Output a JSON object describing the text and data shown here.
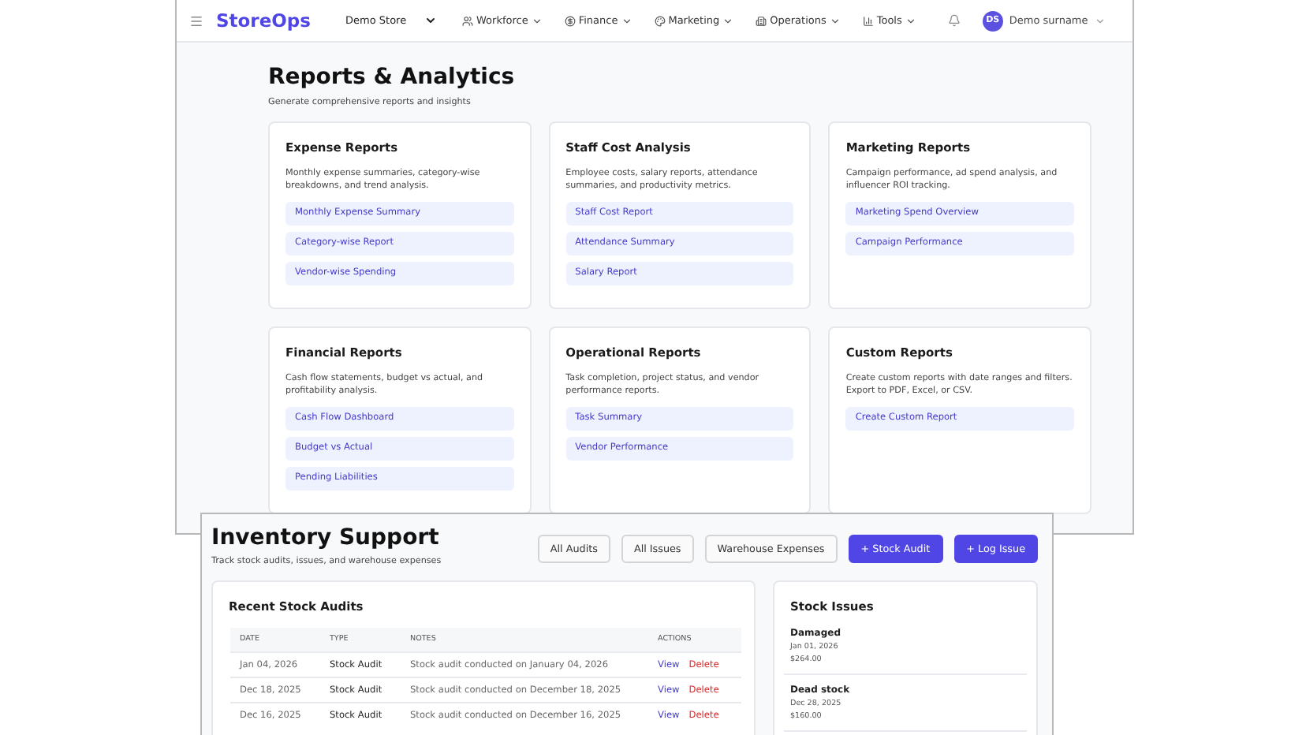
{
  "navbar": {
    "logo": "StoreOps",
    "store": "Demo Store",
    "menus": [
      "Workforce",
      "Finance",
      "Marketing",
      "Operations",
      "Tools"
    ],
    "user": {
      "initials": "DS",
      "name": "Demo surname"
    }
  },
  "reports": {
    "title": "Reports & Analytics",
    "subtitle": "Generate comprehensive reports and insights",
    "cards": [
      {
        "title": "Expense Reports",
        "description": "Monthly expense summaries, category-wise breakdowns, and trend analysis.",
        "links": [
          "Monthly Expense Summary",
          "Category-wise Report",
          "Vendor-wise Spending"
        ]
      },
      {
        "title": "Staff Cost Analysis",
        "description": "Employee costs, salary reports, attendance summaries, and productivity metrics.",
        "links": [
          "Staff Cost Report",
          "Attendance Summary",
          "Salary Report"
        ]
      },
      {
        "title": "Marketing Reports",
        "description": "Campaign performance, ad spend analysis, and influencer ROI tracking.",
        "links": [
          "Marketing Spend Overview",
          "Campaign Performance"
        ]
      },
      {
        "title": "Financial Reports",
        "description": "Cash flow statements, budget vs actual, and profitability analysis.",
        "links": [
          "Cash Flow Dashboard",
          "Budget vs Actual",
          "Pending Liabilities"
        ]
      },
      {
        "title": "Operational Reports",
        "description": "Task completion, project status, and vendor performance reports.",
        "links": [
          "Task Summary",
          "Vendor Performance"
        ]
      },
      {
        "title": "Custom Reports",
        "description": "Create custom reports with date ranges and filters. Export to PDF, Excel, or CSV.",
        "links": [
          "Create Custom Report"
        ]
      }
    ]
  },
  "inventory": {
    "title": "Inventory Support",
    "subtitle": "Track stock audits, issues, and warehouse expenses",
    "buttons": [
      {
        "label": "All Audits",
        "kind": "outline"
      },
      {
        "label": "All Issues",
        "kind": "outline"
      },
      {
        "label": "Warehouse Expenses",
        "kind": "outline"
      },
      {
        "label": "+ Stock Audit",
        "kind": "primary"
      },
      {
        "label": "+ Log Issue",
        "kind": "primary"
      }
    ],
    "audits": {
      "title": "Recent Stock Audits",
      "columns": [
        "DATE",
        "TYPE",
        "NOTES",
        "ACTIONS"
      ],
      "rows": [
        {
          "date": "Jan 04, 2026",
          "type": "Stock Audit",
          "notes": "Stock audit conducted on January 04, 2026",
          "view": "View",
          "delete": "Delete"
        },
        {
          "date": "Dec 18, 2025",
          "type": "Stock Audit",
          "notes": "Stock audit conducted on December 18, 2025",
          "view": "View",
          "delete": "Delete"
        },
        {
          "date": "Dec 16, 2025",
          "type": "Stock Audit",
          "notes": "Stock audit conducted on December 16, 2025",
          "view": "View",
          "delete": "Delete"
        }
      ]
    },
    "issues": {
      "title": "Stock Issues",
      "items": [
        {
          "name": "Damaged",
          "date": "Jan 01, 2026",
          "amount": "$264.00"
        },
        {
          "name": "Dead stock",
          "date": "Dec 28, 2025",
          "amount": "$160.00"
        }
      ]
    }
  }
}
